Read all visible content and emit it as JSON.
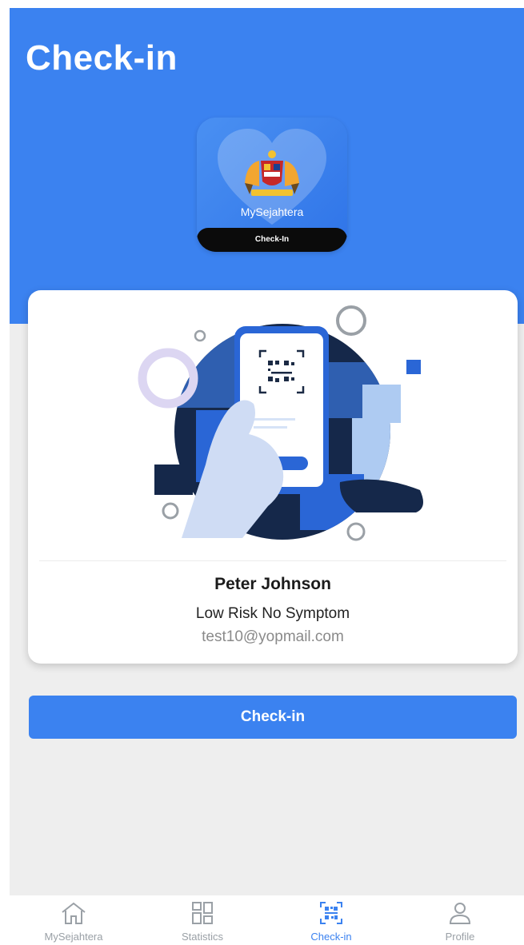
{
  "header": {
    "title": "Check-in"
  },
  "app_logo": {
    "name": "MySejahtera",
    "strip_label": "Check-In"
  },
  "user": {
    "name": "Peter Johnson",
    "risk_status": "Low Risk No Symptom",
    "email": "test10@yopmail.com"
  },
  "actions": {
    "checkin_label": "Check-in"
  },
  "tabbar": {
    "tabs": [
      {
        "label": "MySejahtera",
        "icon": "home-icon",
        "active": false
      },
      {
        "label": "Statistics",
        "icon": "grid-icon",
        "active": false
      },
      {
        "label": "Check-in",
        "icon": "qr-code-icon",
        "active": true
      },
      {
        "label": "Profile",
        "icon": "person-icon",
        "active": false
      }
    ]
  },
  "colors": {
    "primary": "#3b82f0",
    "background": "#eeeeee",
    "illustration_dark": "#15284a"
  }
}
